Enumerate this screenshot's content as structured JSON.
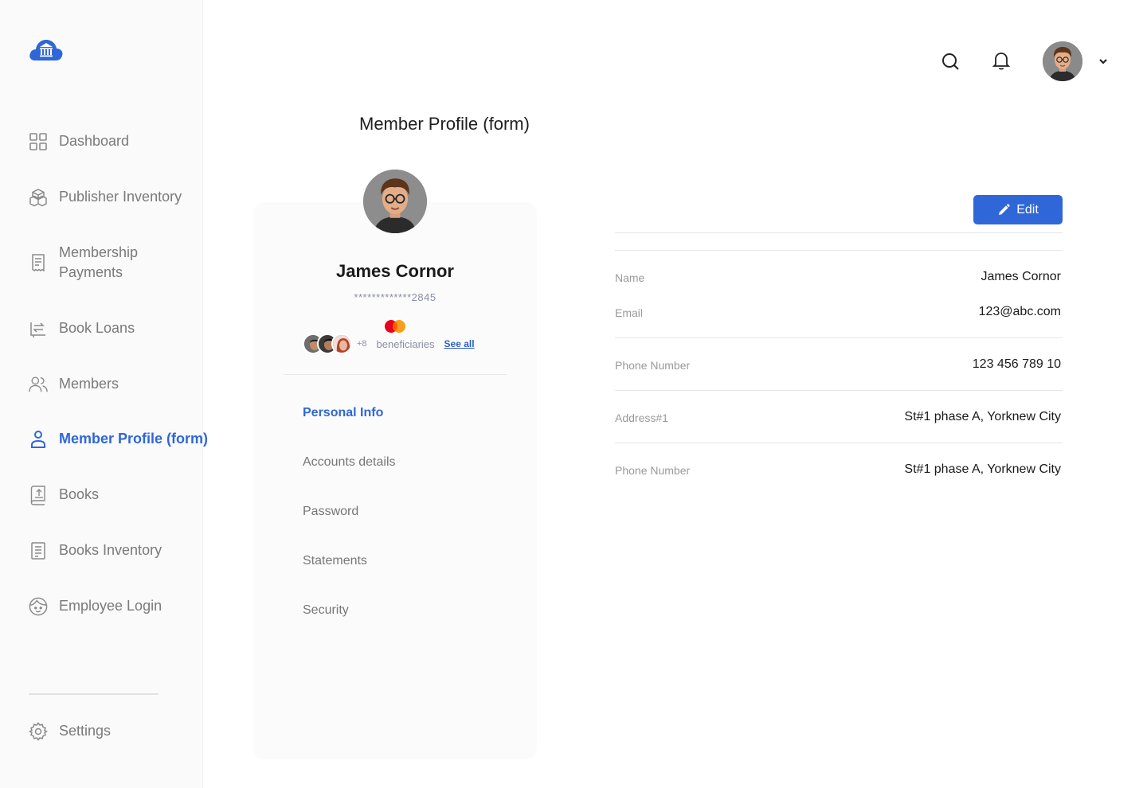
{
  "sidebar": {
    "items": [
      {
        "label": "Dashboard"
      },
      {
        "label": "Publisher Inventory"
      },
      {
        "label": "Membership Payments"
      },
      {
        "label": "Book Loans"
      },
      {
        "label": "Members"
      },
      {
        "label": "Member Profile (form)"
      },
      {
        "label": "Books"
      },
      {
        "label": "Books Inventory"
      },
      {
        "label": "Employee Login"
      }
    ],
    "settings_label": "Settings",
    "active_index": 5
  },
  "header": {
    "icons": [
      "search-icon",
      "bell-icon",
      "chevron-down-icon"
    ]
  },
  "page": {
    "title": "Member Profile (form)"
  },
  "profile": {
    "name": "James Cornor",
    "card_number": "*************2845",
    "card_brand": "mastercard",
    "beneficiaries_more": "+8",
    "beneficiaries_label": "beneficiaries",
    "see_all": "See all",
    "tabs": [
      {
        "label": "Personal Info",
        "active": true
      },
      {
        "label": "Accounts details",
        "active": false
      },
      {
        "label": "Password",
        "active": false
      },
      {
        "label": "Statements",
        "active": false
      },
      {
        "label": "Security",
        "active": false
      }
    ]
  },
  "details": {
    "edit_label": "Edit",
    "fields": [
      {
        "label": "Name",
        "value": "James Cornor"
      },
      {
        "label": "Email",
        "value": "123@abc.com"
      },
      {
        "label": "Phone Number",
        "value": "123 456 789 10"
      },
      {
        "label": "Address#1",
        "value": "St#1 phase A, Yorknew City"
      },
      {
        "label": "Phone Number",
        "value": "St#1 phase A, Yorknew City"
      }
    ]
  },
  "colors": {
    "accent": "#2f67d8",
    "muted_text": "#7a7a7a"
  }
}
